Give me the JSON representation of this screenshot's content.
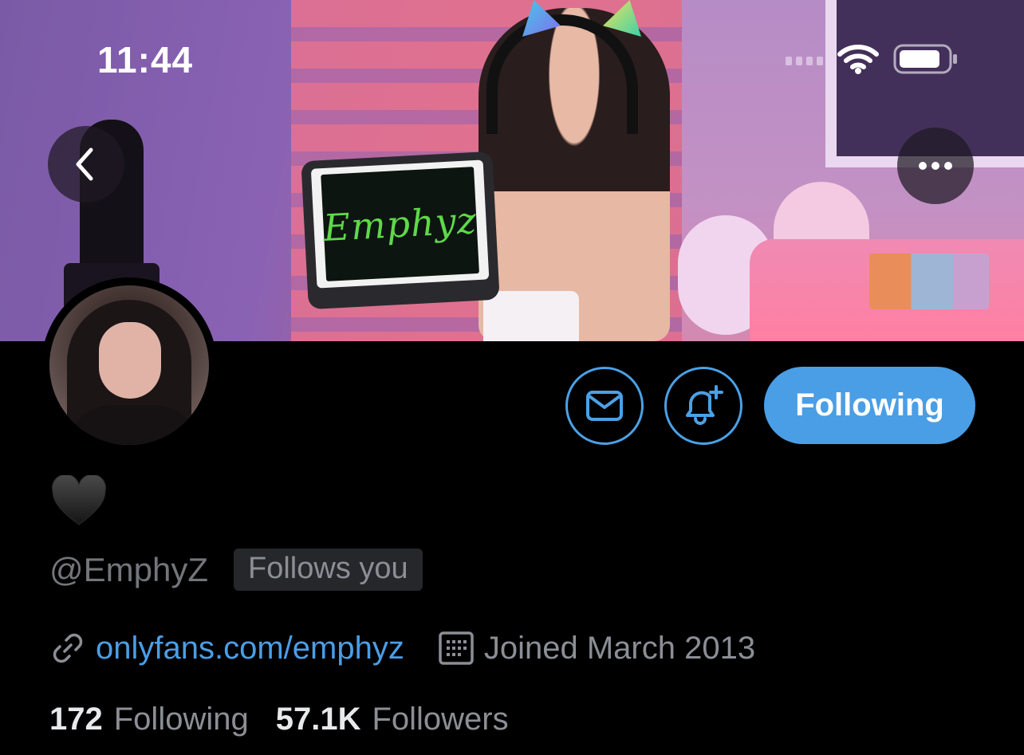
{
  "status_bar": {
    "time": "11:44"
  },
  "banner": {
    "tablet_text": "Emphyz"
  },
  "header_actions": {
    "back_icon": "chevron-left-icon",
    "more_icon": "more-horizontal-icon"
  },
  "profile": {
    "display_name_emoji": "🖤",
    "handle": "@EmphyZ",
    "follows_you_badge": "Follows you",
    "website": "onlyfans.com/emphyz",
    "joined": "Joined March 2013",
    "following_count": "172",
    "following_label": "Following",
    "followers_count": "57.1K",
    "followers_label": "Followers"
  },
  "actions": {
    "message_icon": "mail-icon",
    "notify_icon": "bell-plus-icon",
    "follow_state_label": "Following"
  },
  "colors": {
    "accent": "#4a9ee6",
    "background": "#000000",
    "muted_text": "#8b8f95"
  }
}
